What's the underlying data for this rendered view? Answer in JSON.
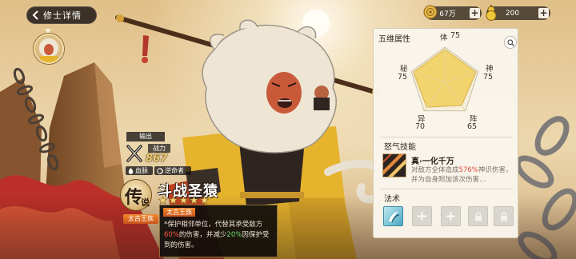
{
  "header": {
    "title": "修士详情"
  },
  "currencies": [
    {
      "icon": "coin-icon",
      "value": "67万"
    },
    {
      "icon": "gourd-icon",
      "value": "200"
    }
  ],
  "stats": {
    "title": "五维属性",
    "attributes": [
      {
        "name": "体",
        "value": 75
      },
      {
        "name": "秘",
        "value": 75
      },
      {
        "name": "神",
        "value": 75
      },
      {
        "name": "异",
        "value": 70
      },
      {
        "name": "阵",
        "value": 65
      }
    ]
  },
  "anger_skill": {
    "title": "怒气技能",
    "icon": "skill-slash-icon",
    "name": "真·一化千万",
    "desc_prefix": "对敌方全体造成",
    "desc_highlight": "576%",
    "desc_suffix": "神识伤害，并为自身附加该次伤害…"
  },
  "spells": {
    "title": "法术",
    "slots": [
      {
        "state": "filled",
        "icon": "wind-spell-icon"
      },
      {
        "state": "empty",
        "icon": "plus-icon"
      },
      {
        "state": "empty",
        "icon": "plus-icon"
      },
      {
        "state": "locked",
        "icon": "lock-icon"
      },
      {
        "state": "locked",
        "icon": "lock-icon"
      }
    ]
  },
  "character": {
    "role": "输出",
    "power_label": "战力",
    "power": "867",
    "bloodline": "血脉",
    "fate": "逆命者",
    "rank_main": "传",
    "rank_sub": "说",
    "name": "斗战圣猿",
    "stars": 5,
    "race": "太古王族"
  },
  "race_tooltip": {
    "title": "太古王族",
    "text_1": "*保护相邻单位，代替其承受敌方",
    "value_1": "60%",
    "text_2": "的伤害，并减少",
    "value_2": "20%",
    "text_3": "因保护受到的伤害。"
  },
  "colors": {
    "damage_highlight": "#e4463a",
    "reduction_highlight": "#6fdc6f",
    "race_tag": "#e0742a",
    "power_text": "#f3cf73"
  }
}
